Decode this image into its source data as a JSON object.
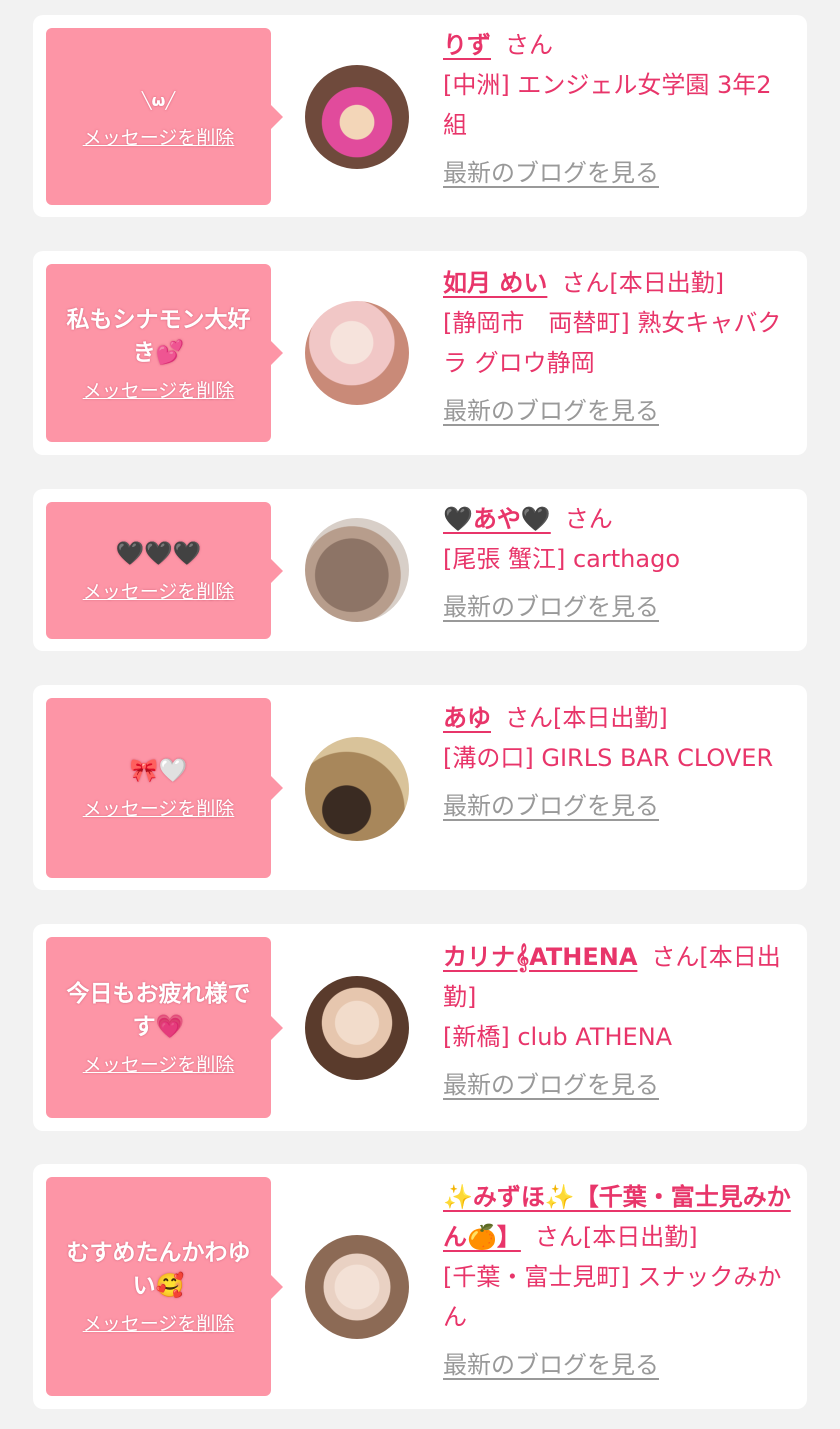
{
  "common": {
    "delete_label": "メッセージを削除",
    "blog_label": "最新のブログを見る",
    "san_label": "さん"
  },
  "colors": {
    "accent": "#e8356a",
    "bubble": "#fd95a6",
    "link_gray": "#999999",
    "background": "#f2f2f2"
  },
  "cards": [
    {
      "message": "╲ω╱",
      "name": "りず",
      "suffix": "さん",
      "shop": "[中洲] エンジェル女学園 3年2組",
      "avatar_colors": [
        "#e14b9c",
        "#6f4a3c"
      ]
    },
    {
      "message": "私もシナモン大好き💕",
      "name": "如月 めい",
      "suffix": "さん[本日出勤]",
      "shop": "[静岡市　両替町] 熟女キャバクラ グロウ静岡",
      "avatar_colors": [
        "#f1c7c6",
        "#c98a78"
      ]
    },
    {
      "message": "🖤🖤🖤",
      "name": "🖤あや🖤",
      "suffix": "さん",
      "shop": "[尾張 蟹江] carthago",
      "avatar_colors": [
        "#8d7466",
        "#d8cfc8"
      ]
    },
    {
      "message": "🎀🤍",
      "name": "あゆ",
      "suffix": "さん[本日出勤]",
      "shop": "[溝の口] GIRLS BAR CLOVER",
      "avatar_colors": [
        "#a8875b",
        "#3a2b22"
      ]
    },
    {
      "message": "今日もお疲れ様です💗",
      "name": "カリナ𝄞ATHENA",
      "suffix": "さん[本日出勤]",
      "shop": "[新橋] club ATHENA",
      "avatar_colors": [
        "#e6c6ae",
        "#5a3b2c"
      ]
    },
    {
      "message": "むすめたんかわゆい🥰",
      "name": "✨みずほ✨【千葉・富士見みかん🍊】",
      "suffix": "さん[本日出勤]",
      "shop": "[千葉・富士見町] スナックみかん",
      "avatar_colors": [
        "#e9d1c3",
        "#8c6a55"
      ]
    }
  ]
}
